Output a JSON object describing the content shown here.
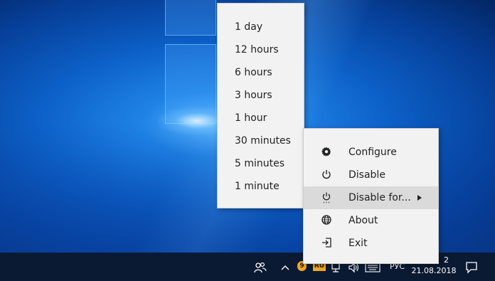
{
  "submenu": {
    "items": [
      "1 day",
      "12 hours",
      "6 hours",
      "3 hours",
      "1 hour",
      "30 minutes",
      "5 minutes",
      "1 minute"
    ]
  },
  "context_menu": {
    "items": [
      {
        "label": "Configure",
        "icon": "gear-icon"
      },
      {
        "label": "Disable",
        "icon": "power-icon"
      },
      {
        "label": "Disable for...",
        "icon": "power-timer-icon",
        "highlighted": true,
        "has_submenu": true
      },
      {
        "label": "About",
        "icon": "globe-icon"
      },
      {
        "label": "Exit",
        "icon": "exit-icon"
      }
    ]
  },
  "taskbar": {
    "badge_ru": "RU",
    "badge_num": "9",
    "language": "РУС",
    "time_partial": "2",
    "date": "21.08.2018"
  },
  "colors": {
    "menu_bg": "#f2f2f2",
    "highlight": "#dadada",
    "taskbar": "#0b1a33"
  }
}
